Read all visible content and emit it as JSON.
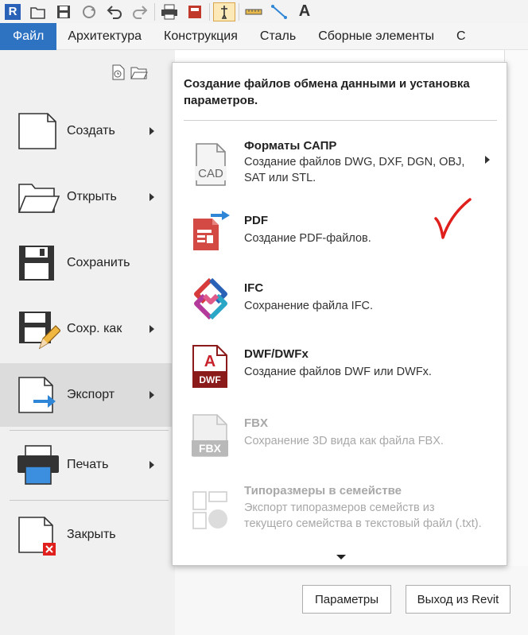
{
  "ribbon": {
    "tabs": [
      {
        "label": "Файл",
        "active": true
      },
      {
        "label": "Архитектура"
      },
      {
        "label": "Конструкция"
      },
      {
        "label": "Сталь"
      },
      {
        "label": "Сборные элементы"
      },
      {
        "label": "С"
      }
    ]
  },
  "toolbar": {
    "icons": [
      "revit-logo-icon",
      "open-icon",
      "save-icon",
      "sync-icon",
      "undo-icon",
      "redo-icon",
      "print-icon",
      "measure-icon",
      "text-icon"
    ],
    "logo_text": "R",
    "text_tool_label": "A"
  },
  "file_menu": {
    "items": [
      {
        "label": "Создать",
        "icon": "new-file-icon",
        "has_submenu": true
      },
      {
        "label": "Открыть",
        "icon": "open-folder-icon",
        "has_submenu": true
      },
      {
        "label": "Сохранить",
        "icon": "save-icon",
        "has_submenu": false
      },
      {
        "label": "Сохр. как",
        "icon": "save-as-icon",
        "has_submenu": true
      },
      {
        "label": "Экспорт",
        "icon": "export-icon",
        "has_submenu": true,
        "selected": true
      },
      {
        "label": "Печать",
        "icon": "print-icon",
        "has_submenu": true
      },
      {
        "label": "Закрыть",
        "icon": "close-file-icon",
        "has_submenu": false
      }
    ]
  },
  "export_panel": {
    "title": "Создание файлов обмена данными и установка параметров.",
    "options": [
      {
        "title": "Форматы САПР",
        "description": "Создание файлов DWG, DXF, DGN, OBJ, SAT или STL.",
        "icon": "cad-file-icon",
        "icon_text": "CAD",
        "has_submenu": true
      },
      {
        "title": "PDF",
        "description": "Создание PDF-файлов.",
        "icon": "pdf-export-icon"
      },
      {
        "title": "IFC",
        "description": "Сохранение файла IFC.",
        "icon": "ifc-logo-icon"
      },
      {
        "title": "DWF/DWFx",
        "description": "Создание файлов DWF или DWFx.",
        "icon": "dwf-file-icon",
        "icon_text": "DWF",
        "icon_letter": "A"
      },
      {
        "title": "FBX",
        "description": "Сохранение 3D вида как файла FBX.",
        "icon": "fbx-file-icon",
        "icon_text": "FBX",
        "disabled": true
      },
      {
        "title": "Типоразмеры в семействе",
        "description": "Экспорт типоразмеров семейств из текущего семейства в текстовый файл (.txt).",
        "icon": "family-types-icon",
        "disabled": true
      }
    ]
  },
  "buttons": {
    "options": "Параметры",
    "exit": "Выход из Revit"
  },
  "colors": {
    "accent": "#2e72c2",
    "checkmark": "#e0201c",
    "pdf_red": "#d24a43",
    "export_arrow": "#2f86d6"
  }
}
